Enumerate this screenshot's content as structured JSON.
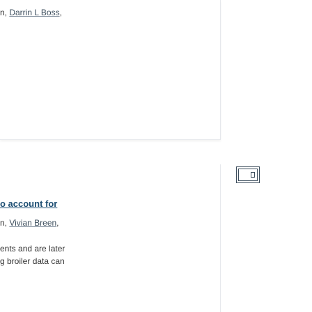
{
  "results": [
    {
      "authors_lead": "n, ",
      "author_link": "Darrin L Boss",
      "authors_tail": ","
    },
    {
      "title": "o account for",
      "authors_lead": "n, ",
      "author_link": "Vivian Breen",
      "authors_tail": ",",
      "snippet_line1": "ents and are later",
      "snippet_line2": "g broiler data can"
    }
  ],
  "actions": {
    "reader_icon": "document-icon"
  }
}
